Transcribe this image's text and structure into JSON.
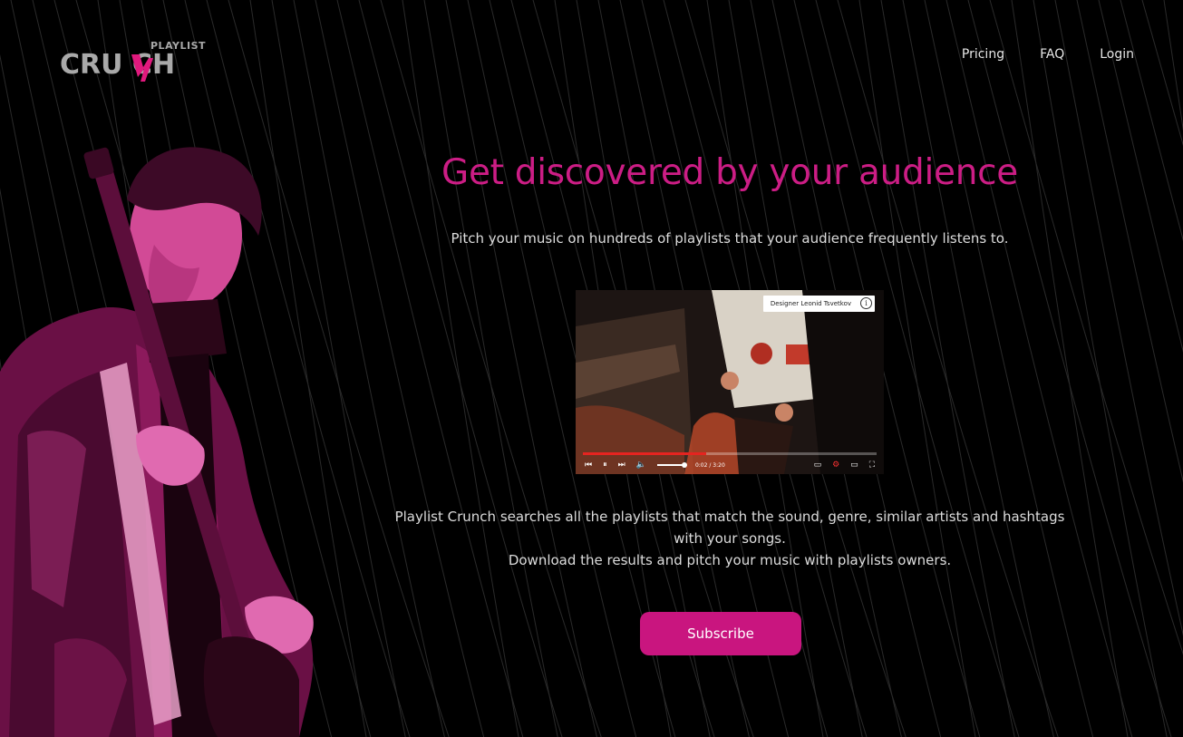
{
  "brand": {
    "logo_word": "CRU  CH",
    "logo_superscript": "PLAYLIST",
    "logo_name": "Playlist Crunch",
    "accent_color": "#cc1d85",
    "bolt_color": "#e0197d"
  },
  "nav": {
    "items": [
      {
        "label": "Pricing"
      },
      {
        "label": "FAQ"
      },
      {
        "label": "Login"
      }
    ]
  },
  "hero": {
    "headline": "Get discovered by your audience",
    "subhead": "Pitch your music on hundreds of playlists that your audience frequently listens to.",
    "image_icon": "guitarist-photo"
  },
  "video": {
    "credit": "Designer Leonid Tsvetkov",
    "info_icon": "info-icon",
    "time_current": "0:02",
    "time_total": "3:20",
    "progress_fraction": 0.42,
    "controls": [
      "previous-icon",
      "pause-icon",
      "next-icon",
      "volume-icon",
      "captions-icon",
      "settings-icon",
      "theater-icon",
      "fullscreen-icon"
    ]
  },
  "description": {
    "line1": "Playlist Crunch searches all the playlists that match the sound, genre, similar artists and hashtags with your songs.",
    "line2": "Download the results and pitch your music with playlists owners."
  },
  "cta": {
    "subscribe_label": "Subscribe"
  }
}
